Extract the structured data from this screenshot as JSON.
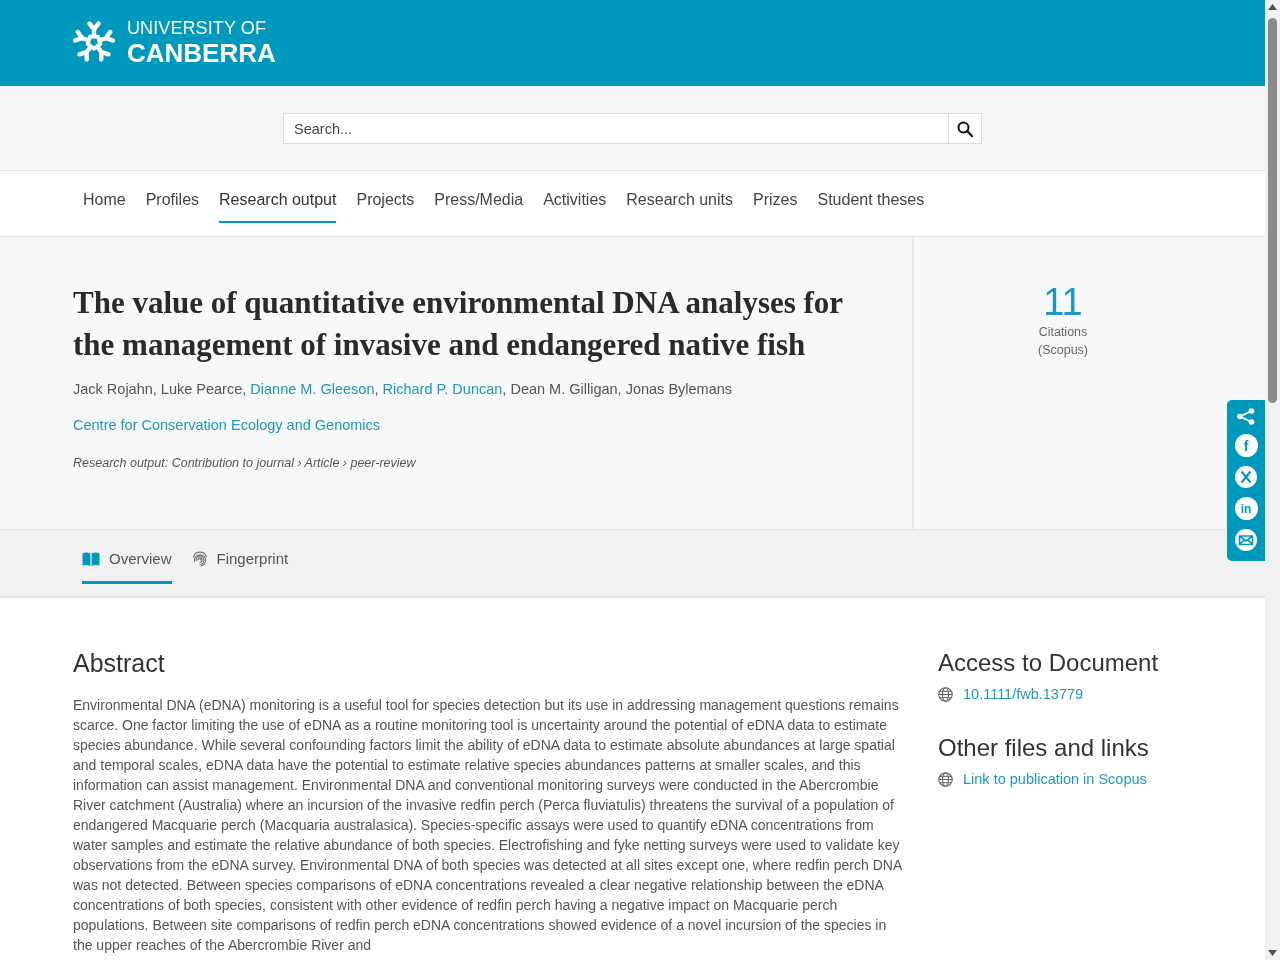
{
  "header": {
    "logo": {
      "line_1": "UNIVERSITY OF",
      "line_2": "CANBERRA"
    }
  },
  "search": {
    "placeholder": "Search..."
  },
  "nav": [
    {
      "label": "Home",
      "selected": false
    },
    {
      "label": "Profiles",
      "selected": false
    },
    {
      "label": "Research output",
      "selected": true
    },
    {
      "label": "Projects",
      "selected": false
    },
    {
      "label": "Press/Media",
      "selected": false
    },
    {
      "label": "Activities",
      "selected": false
    },
    {
      "label": "Research units",
      "selected": false
    },
    {
      "label": "Prizes",
      "selected": false
    },
    {
      "label": "Student theses",
      "selected": false
    }
  ],
  "publication": {
    "title": "The value of quantitative environmental DNA analyses for the management of invasive and endangered native fish",
    "authors": [
      {
        "kind": "text",
        "text": "Jack Rojahn, Luke Pearce, "
      },
      {
        "kind": "link",
        "text": "Dianne M. Gleeson"
      },
      {
        "kind": "text",
        "text": ", "
      },
      {
        "kind": "link",
        "text": "Richard P. Duncan"
      },
      {
        "kind": "text",
        "text": ", Dean M. Gilligan, Jonas Bylemans"
      }
    ],
    "unit": "Centre for Conservation Ecology and Genomics",
    "output_type": "Research output: Contribution to journal › Article › peer-review"
  },
  "citations": {
    "count": "11",
    "label": "Citations",
    "source": "(Scopus)"
  },
  "share_bar": [
    {
      "kind": "share"
    },
    {
      "kind": "facebook",
      "glyph": "f"
    },
    {
      "kind": "x"
    },
    {
      "kind": "linkedin",
      "glyph": "in"
    },
    {
      "kind": "email"
    }
  ],
  "tabs": [
    {
      "label": "Overview",
      "selected": true
    },
    {
      "label": "Fingerprint",
      "selected": false
    }
  ],
  "abstract": {
    "heading": "Abstract",
    "text": "Environmental DNA (eDNA) monitoring is a useful tool for species detection but its use in addressing management questions remains scarce. One factor limiting the use of eDNA as a routine monitoring tool is uncertainty around the potential of eDNA data to estimate species abundance. While several confounding factors limit the ability of eDNA data to estimate absolute abundances at large spatial and temporal scales, eDNA data have the potential to estimate relative species abundances patterns at smaller scales, and this information can assist management. Environmental DNA and conventional monitoring surveys were conducted in the Abercrombie River catchment (Australia) where an incursion of the invasive redfin perch (Perca fluviatulis) threatens the survival of a population of endangered Macquarie perch (Macquaria australasica). Species-specific assays were used to quantify eDNA concentrations from water samples and estimate the relative abundance of both species. Electrofishing and fyke netting surveys were used to validate key observations from the eDNA survey. Environmental DNA of both species was detected at all sites except one, where redfin perch DNA was not detected. Between species comparisons of eDNA concentrations revealed a clear negative relationship between the eDNA concentrations of both species, consistent with other evidence of redfin perch having a negative impact on Macquarie perch populations. Between site comparisons of redfin perch eDNA concentrations showed evidence of a novel incursion of the species in the upper reaches of the Abercrombie River and"
  },
  "sidebar": [
    {
      "heading": "Access to Document",
      "links": [
        "10.1111/fwb.13779"
      ]
    },
    {
      "heading": "Other files and links",
      "links": [
        "Link to publication in Scopus"
      ]
    }
  ]
}
